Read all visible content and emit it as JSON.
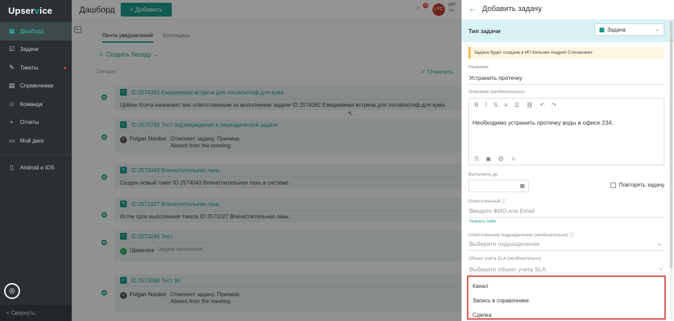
{
  "sidebar": {
    "logo_a": "Upser",
    "logo_v": "v",
    "logo_b": "ice",
    "items": [
      {
        "label": "Дашборд",
        "icon": "grid-icon",
        "glyph": "▦"
      },
      {
        "label": "Задачи",
        "icon": "tasks-icon",
        "glyph": "☑"
      },
      {
        "label": "Тикеты",
        "icon": "tickets-icon",
        "glyph": "✎"
      },
      {
        "label": "Справочники",
        "icon": "book-icon",
        "glyph": "▤"
      },
      {
        "label": "Команда",
        "icon": "team-icon",
        "glyph": "☺"
      },
      {
        "label": "Отчеты",
        "icon": "chart-icon",
        "glyph": "⌁"
      },
      {
        "label": "Мой диск",
        "icon": "folder-icon",
        "glyph": "▭"
      }
    ],
    "mobile": {
      "label": "Android и iOS",
      "icon": "phone-icon",
      "glyph": "▯"
    },
    "collapse_label": "< Свернуть",
    "support_glyph": "◎"
  },
  "topbar": {
    "title": "Дашборд",
    "add_button": "+ Добавить",
    "bell_glyph": "♪",
    "notif_count": "99",
    "avatar_text": "LFC",
    "user_short": "ИП",
    "user_short2": "Ale"
  },
  "main": {
    "tabs": [
      "Лента уведомлений",
      "Календарь"
    ],
    "create_chat": "☺ Создать беседу ⌄",
    "today": "Сегодня",
    "mark_all": "✓ Отметить",
    "feed": [
      {
        "title": "ID 2574362 Ежедневная встреча для логов/нотиф для кума",
        "body": "Uptime Kuma назначает вас ответственным за выполнение задачи ID 2574362 Ежедневная встреча для логов/нотиф для кума."
      },
      {
        "title": "ID 2570763 Тест подтверждения в периодической задаче",
        "author": "Folgan Nordon",
        "author_init": "F",
        "line1": "Отменяет задачу. Причина:",
        "line2": "Absent from the meeting"
      },
      {
        "title": "ID 2574043 Впечатлительная лань",
        "body": "Создан новый тикет ID 2574043 Впечатлительная лань в системе."
      },
      {
        "title": "ID 2571027 Впечатлительная лань",
        "body": "Истек срок выполнения тикета ID 2571027 Впечатлительная лань."
      },
      {
        "title": "ID 2573240 Тест",
        "author": "Upservice",
        "author_init": "✓",
        "line1": "Задача просрочена."
      },
      {
        "title": "ID 2573068 Тест 34",
        "author": "Folgan Nordon",
        "author_init": "F",
        "line1": "Отменяет задачу. Причина:",
        "line2": "Absent from the meeting"
      }
    ]
  },
  "panel": {
    "title": "Добавить задачу",
    "type_label": "Тип задачи",
    "type_value": "Задача",
    "info": "Задача будет создана в ИП Кильник Андрей Степанович",
    "name_label": "Название",
    "name_value": "Устранить протечку",
    "desc_label": "Описание (необязательно)",
    "desc_value": "Необходимо устранить протечку воды в офисе 234.",
    "toolbar": [
      "B",
      "I",
      "S",
      "≡",
      "☰",
      "⛓",
      "↶",
      "↷"
    ],
    "footer_tools": [
      "⎘",
      "▣",
      "@",
      "☺"
    ],
    "due_label": "Выполнить до",
    "repeat_label": "Повторять задачу",
    "assignee_label": "Ответственный ⓘ",
    "assignee_placeholder": "Введите ФИО или Email",
    "assign_self": "Указать себя",
    "dept_label": "Ответственное подразделение (необязательно) ⓘ",
    "dept_placeholder": "Выберите подразделение",
    "sla_label": "Объект учета SLA (необязательно)",
    "sla_placeholder": "Выберите объект учета SLA",
    "dropdown": [
      "Канал",
      "Запись в справочнике",
      "Сделка"
    ]
  }
}
